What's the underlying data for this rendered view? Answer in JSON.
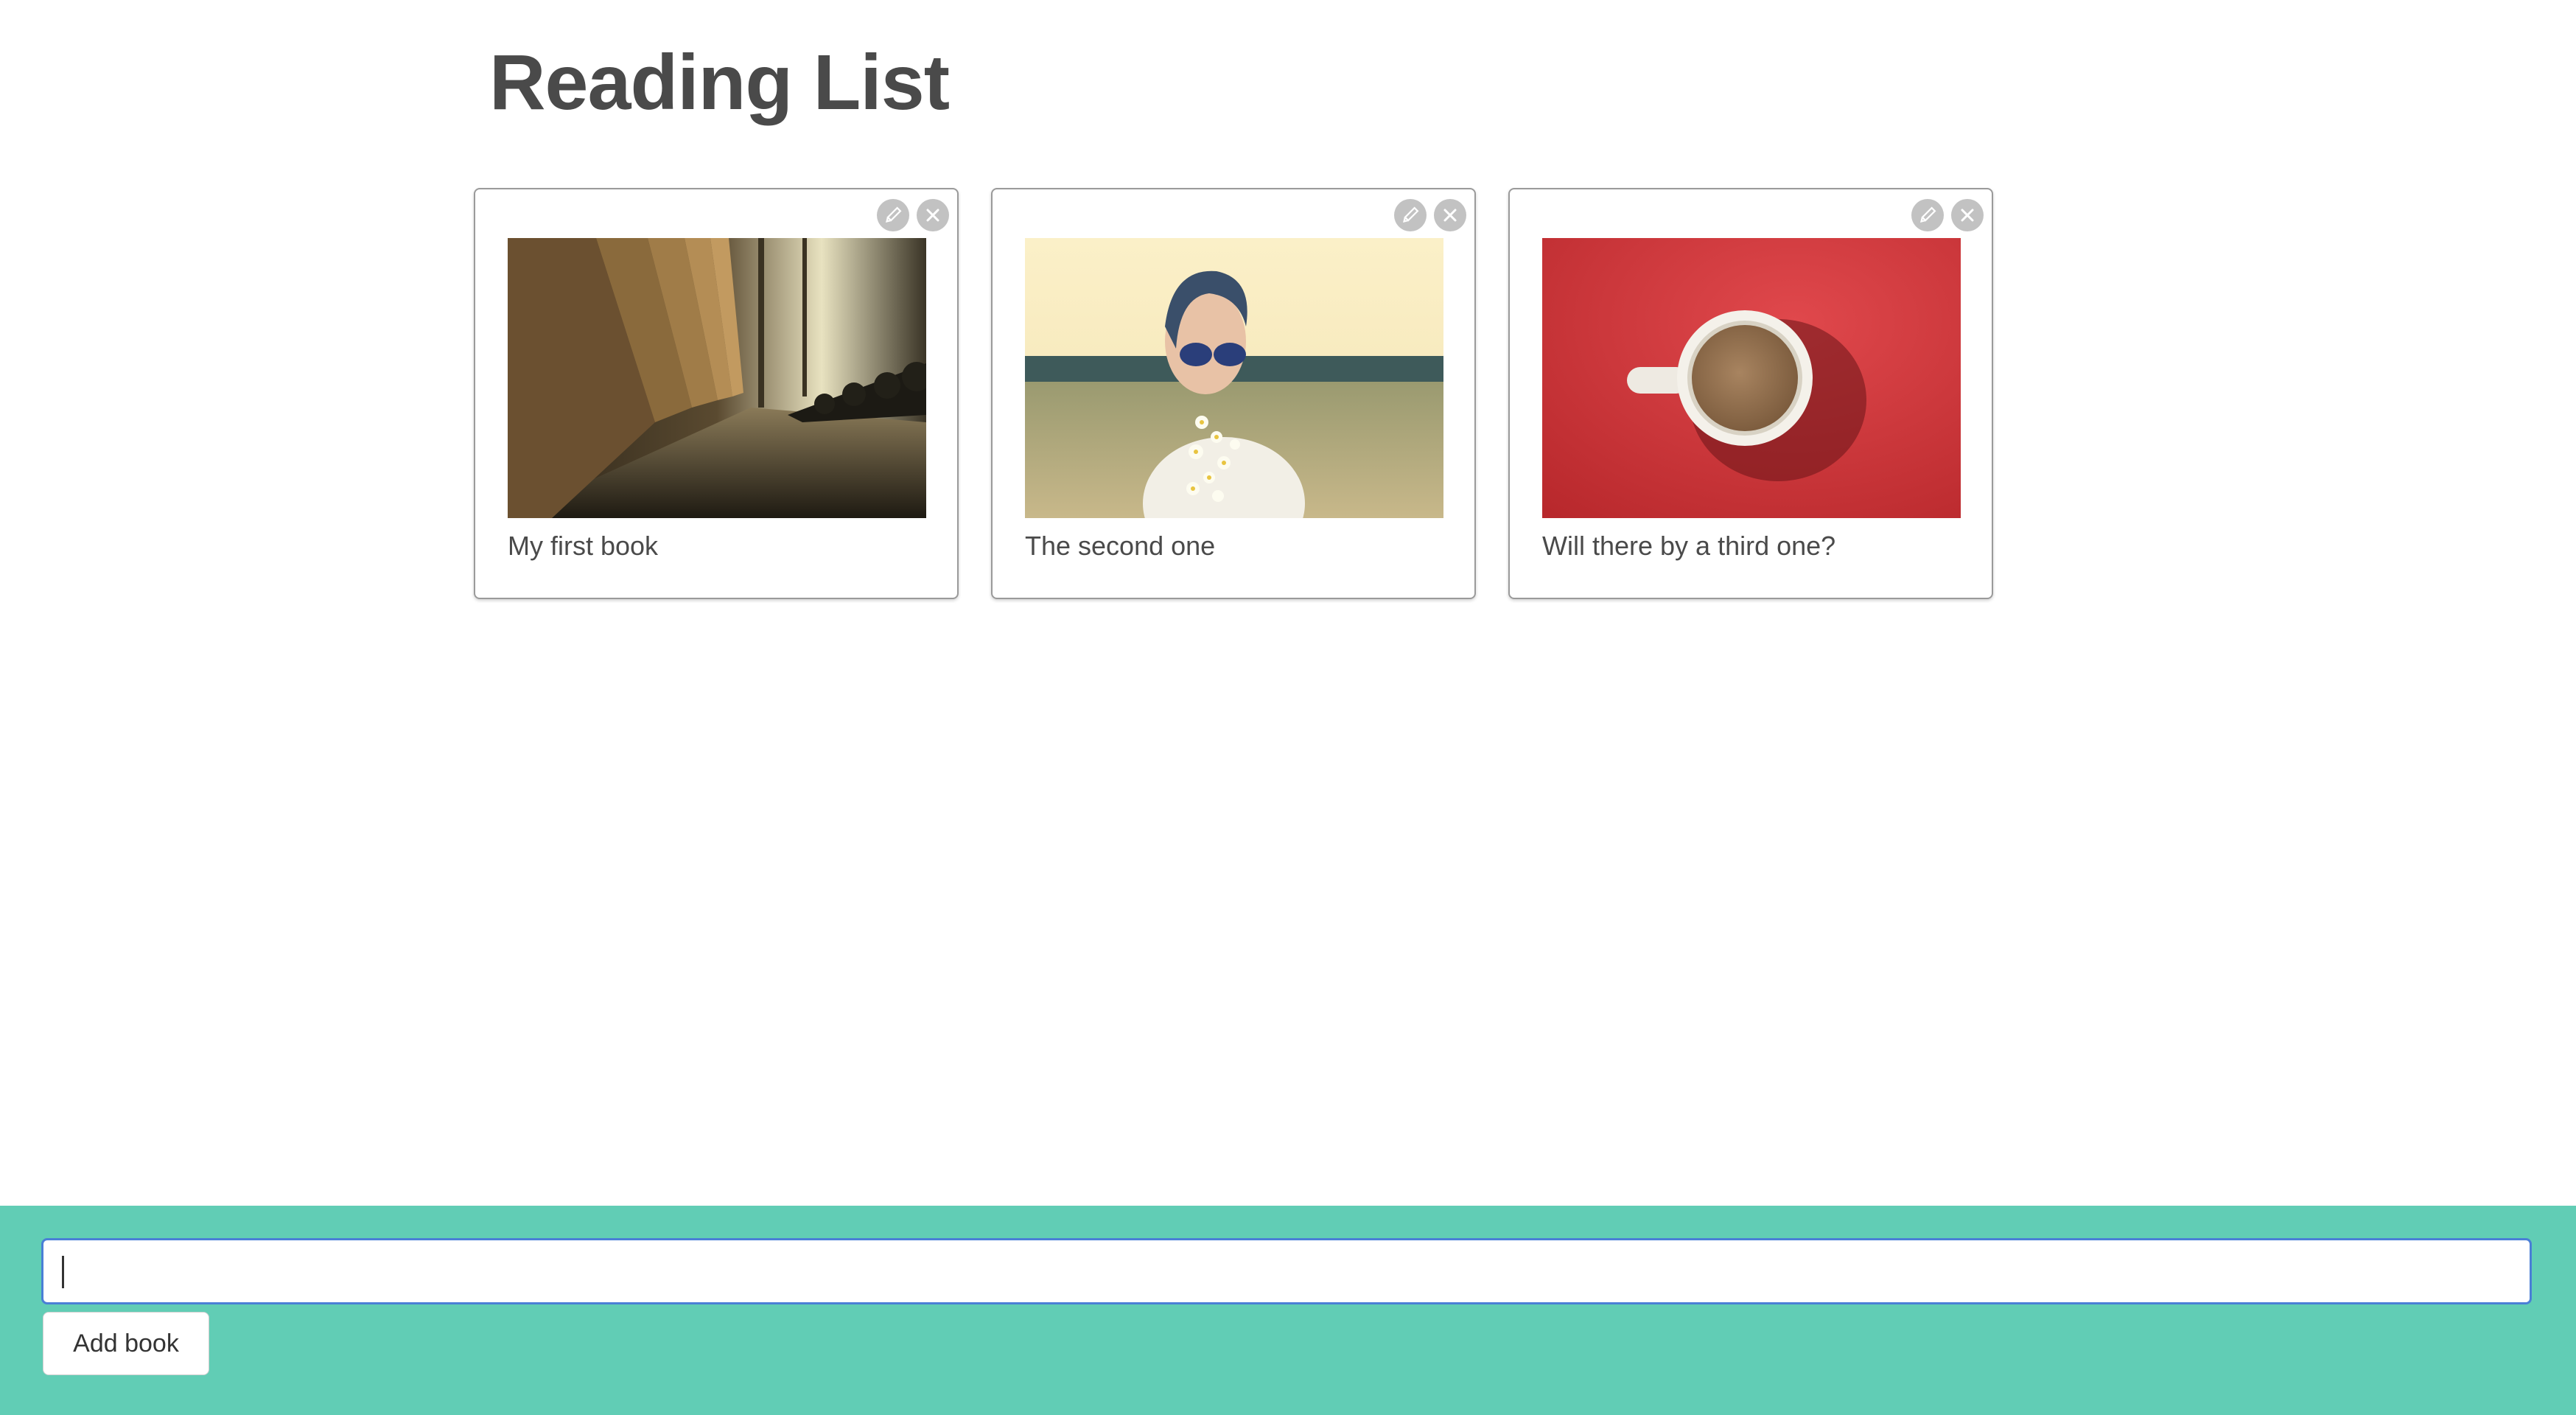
{
  "page": {
    "title": "Reading List"
  },
  "books": [
    {
      "title": "My first book",
      "image": "dim corridor with rows of wooden chairs",
      "edit_icon": "pencil-icon",
      "delete_icon": "close-icon"
    },
    {
      "title": "The second one",
      "image": "woman with sunglasses holding flowers in a field",
      "edit_icon": "pencil-icon",
      "delete_icon": "close-icon"
    },
    {
      "title": "Will there by a third one?",
      "image": "coffee cup on red background",
      "edit_icon": "pencil-icon",
      "delete_icon": "close-icon"
    }
  ],
  "form": {
    "input_value": "",
    "add_button_label": "Add book"
  },
  "colors": {
    "footer_background": "#61cdb5",
    "input_focus_border": "#4a7fd6",
    "title_text": "#4a4a4a",
    "icon_button": "#c2c2c2"
  }
}
